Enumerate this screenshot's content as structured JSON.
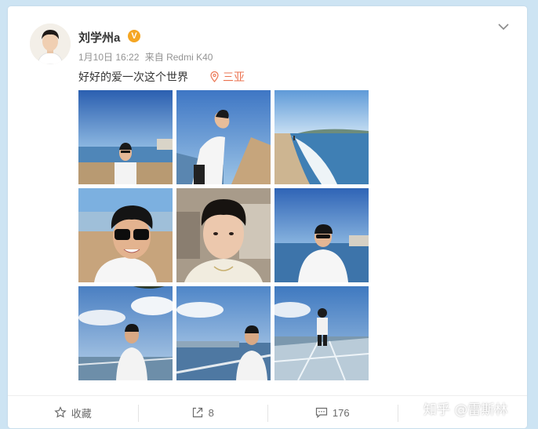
{
  "post": {
    "username": "刘学州a",
    "verified_badge": "V",
    "timestamp": "1月10日 16:22",
    "source": "来自 Redmi K40",
    "text": "好好的爱一次这个世界",
    "location": "三亚"
  },
  "photos": [
    {
      "scene": "beach-portrait"
    },
    {
      "scene": "beach-lean"
    },
    {
      "scene": "shoreline"
    },
    {
      "scene": "selfie-sunglasses"
    },
    {
      "scene": "selfie-indoor"
    },
    {
      "scene": "beach-sunglasses"
    },
    {
      "scene": "balcony-sky"
    },
    {
      "scene": "balcony-city"
    },
    {
      "scene": "glass-platform"
    }
  ],
  "actions": {
    "favorite_label": "收藏",
    "share_count": "8",
    "comment_count": "176",
    "like_label": ""
  },
  "watermark": "知乎 @雷斯林",
  "colors": {
    "page_bg": "#cde4f3",
    "card_bg": "#ffffff",
    "location": "#eb7350",
    "badge": "#f5a623"
  }
}
